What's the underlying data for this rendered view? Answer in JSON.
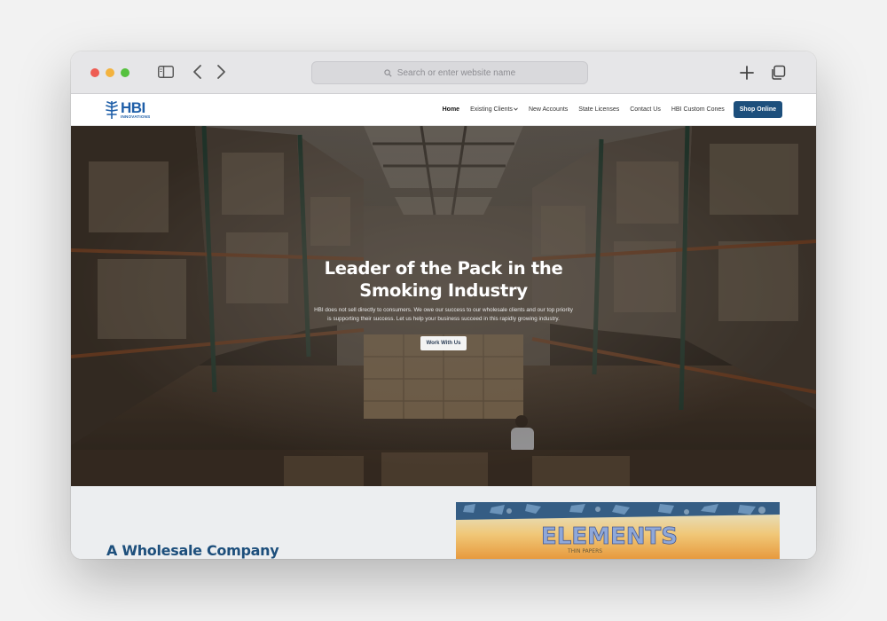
{
  "browser": {
    "address_placeholder": "Search or enter website name"
  },
  "site": {
    "logo": {
      "main": "HBI",
      "sub": "INNOVATIONS"
    },
    "nav": {
      "items": [
        {
          "label": "Home",
          "active": true,
          "has_dropdown": false
        },
        {
          "label": "Existing Clients",
          "active": false,
          "has_dropdown": true
        },
        {
          "label": "New Accounts",
          "active": false,
          "has_dropdown": false
        },
        {
          "label": "State Licenses",
          "active": false,
          "has_dropdown": false
        },
        {
          "label": "Contact Us",
          "active": false,
          "has_dropdown": false
        },
        {
          "label": "HBI Custom Cones",
          "active": false,
          "has_dropdown": false
        }
      ],
      "cta_label": "Shop Online"
    }
  },
  "hero": {
    "title": "Leader of the Pack in the Smoking Industry",
    "text": "HBI does not sell directly to consumers. We owe our success to our wholesale clients and our top priority is supporting their success. Let us help your business succeed in this rapidly growing industry.",
    "button_label": "Work With Us"
  },
  "section": {
    "heading": "A Wholesale Company",
    "product_text": "ELEMENTS",
    "product_subtext": "THIN PAPERS"
  },
  "colors": {
    "brand_blue": "#1d4f7c",
    "logo_blue": "#1f5fa8",
    "heading_blue": "#1d4f7c"
  }
}
